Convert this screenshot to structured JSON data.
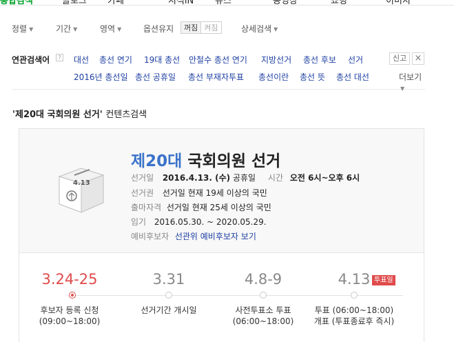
{
  "topnav": {
    "items": [
      "통합검색",
      "블로그",
      "카페",
      "지식iN",
      "뉴스",
      "동영상",
      "쇼핑",
      "이미지"
    ]
  },
  "options": {
    "sort": "정렬",
    "period": "기간",
    "area": "영역",
    "option_keep": "옵션유지",
    "toggle_off": "꺼짐",
    "toggle_on": "켜짐",
    "detail": "상세검색"
  },
  "related": {
    "title": "연관검색어",
    "help": "?",
    "keywords_row1": [
      "대선",
      "총선 연기",
      "19대 총선",
      "안철수 총선 연기",
      "지방선거",
      "총선 후보",
      "선거"
    ],
    "keywords_row2": [
      "2016년 총선일",
      "총선 공휴일",
      "총선 부재자투표",
      "총선이란",
      "총선 뜻",
      "총선 대선"
    ],
    "report": "신고",
    "close": "×",
    "more": "더보기"
  },
  "content_search": {
    "quoted": "'제20대 국회의원 선거'",
    "suffix": "컨텐츠검색"
  },
  "election": {
    "title_num": "제20대",
    "title_rest": "국회의원 선거",
    "ballot_label": "4.13",
    "date_label": "선거일",
    "date_value": "2016.4.13. (수)",
    "holiday": "공휴일",
    "time_label": "시간",
    "time_value": "오전 6시~오후 6시",
    "voters_label": "선거권",
    "voters_value": "선거일 현재 19세 이상의 국민",
    "candidacy_label": "출마자격",
    "candidacy_value": "선거일 현재 25세 이상의 국민",
    "term_label": "임기",
    "term_value": "2016.05.30. ~ 2020.05.29.",
    "precandidate_label": "예비후보자",
    "precandidate_link": "선관위 예비후보자 보기"
  },
  "timeline": {
    "steps": [
      {
        "date": "3.24-25",
        "label1": "후보자 등록 신청",
        "label2": "(09:00~18:00)"
      },
      {
        "date": "3.31",
        "label1": "선거기간 개시일",
        "label2": ""
      },
      {
        "date": "4.8-9",
        "label1": "사전투표소 투표",
        "label2": "(06:00~18:00)"
      },
      {
        "date": "4.13",
        "label1": "투표 (06:00~18:00)",
        "label2": "개표 (투표종료후 즉시)"
      }
    ],
    "badge": "투표일"
  }
}
